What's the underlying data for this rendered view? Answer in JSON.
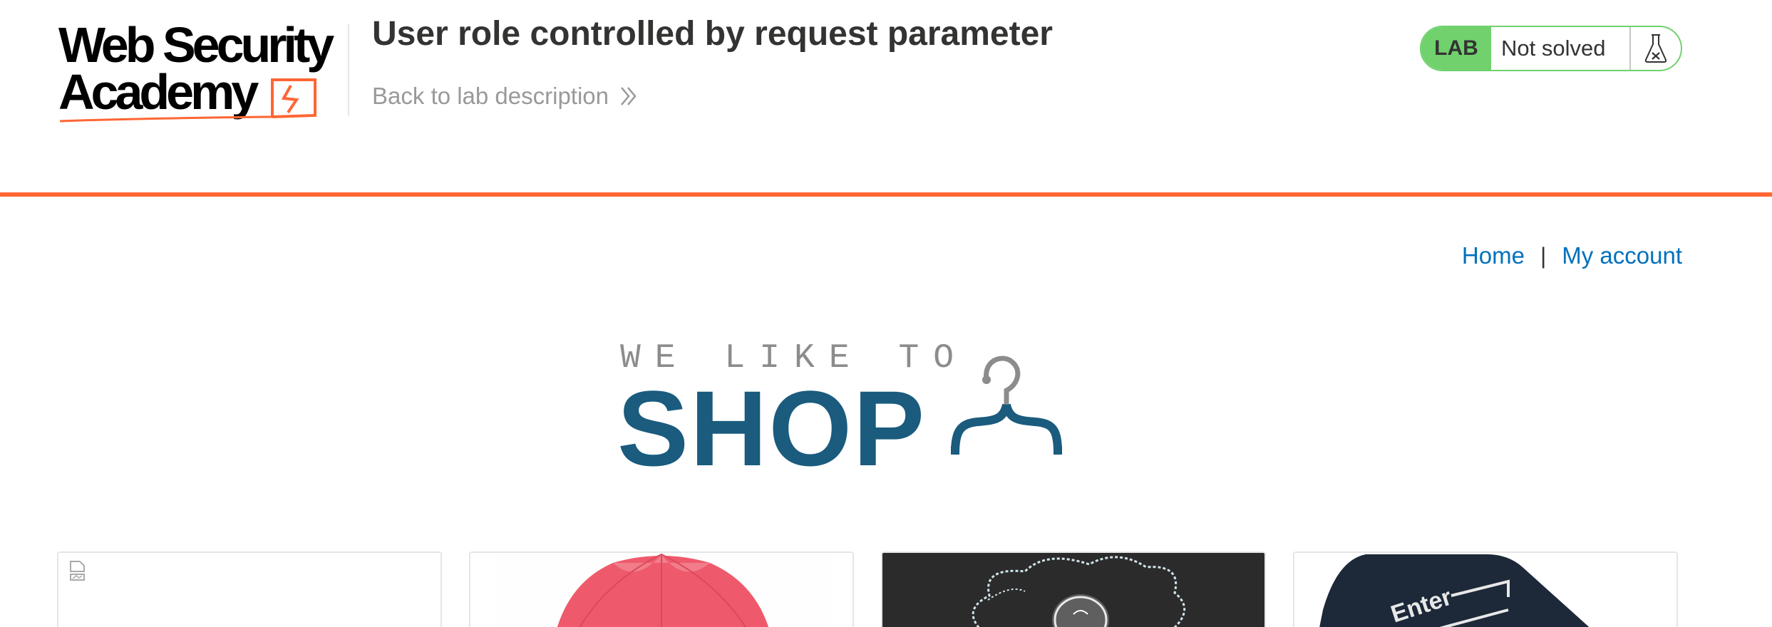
{
  "header": {
    "logo": {
      "line1": "Web Security",
      "line2": "Academy"
    },
    "lab_title": "User role controlled by request parameter",
    "back_link": "Back to lab description",
    "lab_status": {
      "badge": "LAB",
      "status": "Not solved"
    }
  },
  "nav": {
    "home": "Home",
    "separator": "|",
    "my_account": "My account"
  },
  "banner": {
    "small_text": "WE LIKE TO",
    "big_text": "SHOP"
  },
  "products": [
    {
      "image": "broken-image"
    },
    {
      "image": "pink-umbrella"
    },
    {
      "image": "chalkboard-cloud-lightbulb"
    },
    {
      "image": "black-enter-key"
    }
  ],
  "product_texts": {
    "enter_key": "Enter"
  },
  "colors": {
    "accent": "#ff6633",
    "lab_green": "#70d16d",
    "link": "#0071bc",
    "shop_blue": "#1a5b7e"
  }
}
